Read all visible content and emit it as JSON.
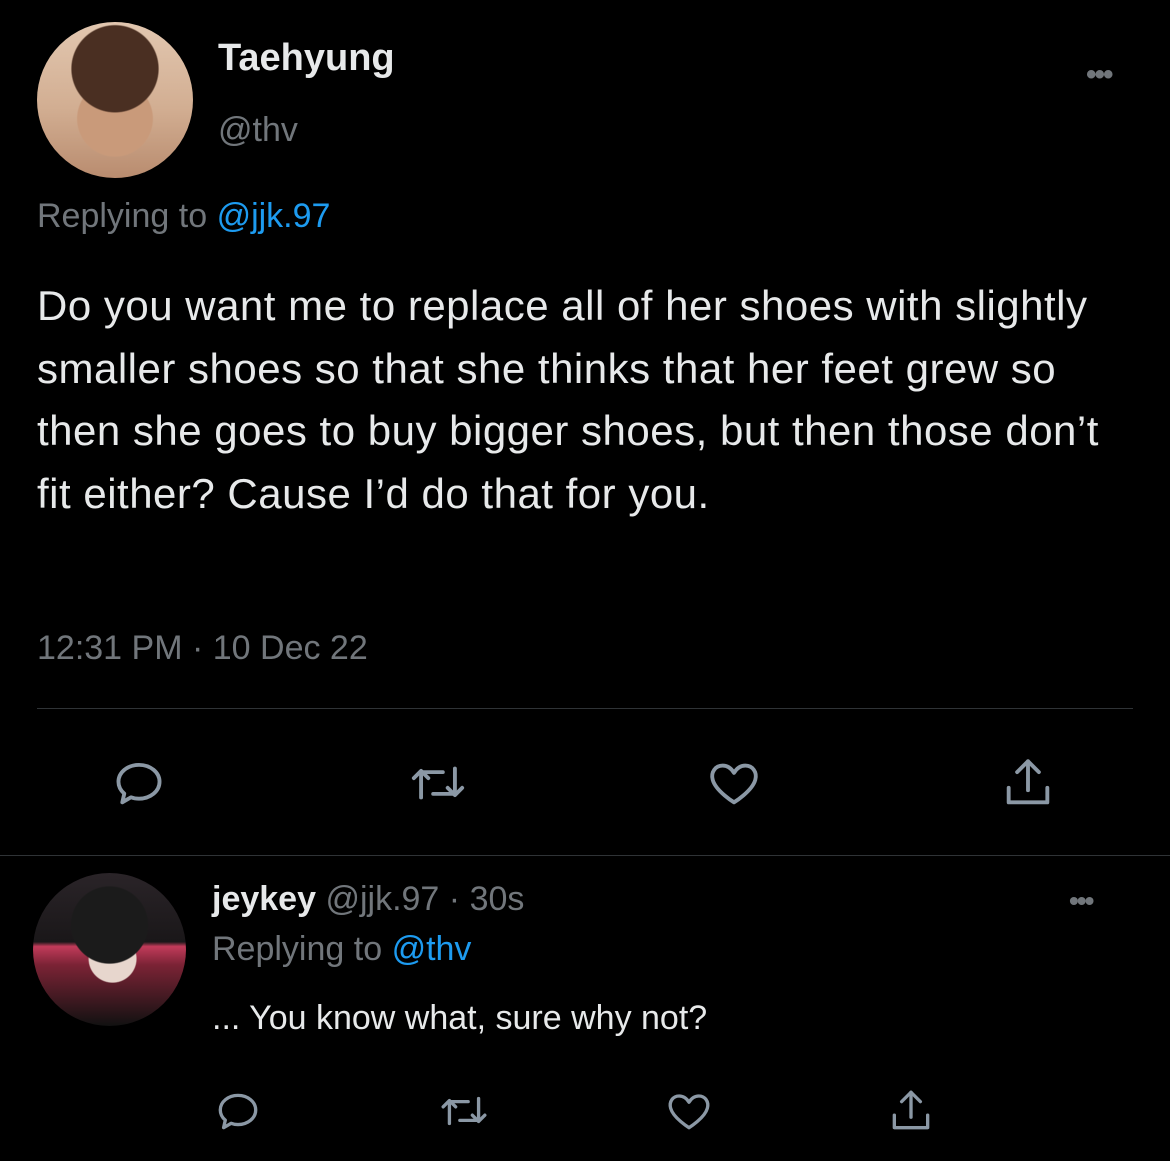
{
  "tweet": {
    "display_name": "Taehyung",
    "handle": "@thv",
    "more_label": "•••",
    "replying_label": "Replying to",
    "replying_handle": "@jjk.97",
    "text": "Do you want me to replace all of her shoes with slightly smaller shoes so that she thinks that her feet grew so then she goes to buy bigger shoes, but then those don’t fit either? Cause I’d do that for you.",
    "timestamp": "12:31 PM · 10 Dec 22"
  },
  "reply": {
    "display_name": "jeykey",
    "handle": "@jjk.97",
    "separator": "·",
    "age": "30s",
    "more_label": "•••",
    "replying_label": "Replying to",
    "replying_handle": "@thv",
    "text": "... You know what, sure why not?"
  },
  "icons": [
    "reply-icon",
    "retweet-icon",
    "like-icon",
    "share-icon"
  ],
  "colors": {
    "background": "#000000",
    "text": "#e7e9ea",
    "muted": "#71767b",
    "link": "#1d9bf0",
    "divider": "#2f3336"
  }
}
